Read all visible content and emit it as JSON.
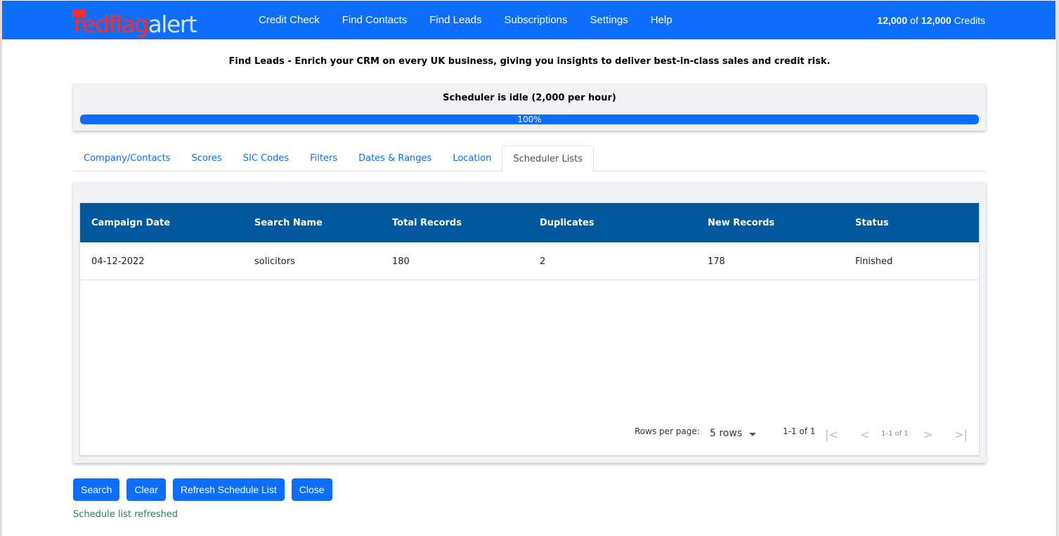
{
  "brand": {
    "logo_part_red": "redflag",
    "logo_part_white": "alert"
  },
  "nav": {
    "items": [
      "Credit Check",
      "Find Contacts",
      "Find Leads",
      "Subscriptions",
      "Settings",
      "Help"
    ],
    "credits_used": "12,000",
    "credits_of": "of",
    "credits_total": "12,000",
    "credits_label": "Credits"
  },
  "page": {
    "subtitle": "Find Leads - Enrich your CRM on every UK business, giving you insights to deliver best-in-class sales and credit risk."
  },
  "scheduler": {
    "status_text": "Scheduler is idle (2,000 per hour)",
    "progress_label": "100%",
    "progress_fraction": 1.0
  },
  "tabs": [
    {
      "label": "Company/Contacts",
      "active": false
    },
    {
      "label": "Scores",
      "active": false
    },
    {
      "label": "SIC Codes",
      "active": false
    },
    {
      "label": "Filters",
      "active": false
    },
    {
      "label": "Dates & Ranges",
      "active": false
    },
    {
      "label": "Location",
      "active": false
    },
    {
      "label": "Scheduler Lists",
      "active": true
    }
  ],
  "table": {
    "columns": [
      "Campaign Date",
      "Search Name",
      "Total Records",
      "Duplicates",
      "New Records",
      "Status"
    ],
    "rows": [
      [
        "04-12-2022",
        "solicitors",
        "180",
        "2",
        "178",
        "Finished"
      ]
    ]
  },
  "pager": {
    "rows_per_page_label": "Rows per page:",
    "rows_per_page_value": "5 rows",
    "range": "1-1 of 1",
    "range_small": "1-1 of 1"
  },
  "buttons": {
    "search": "Search",
    "clear": "Clear",
    "refresh": "Refresh Schedule List",
    "close": "Close"
  },
  "status_message": "Schedule list refreshed",
  "colors": {
    "nav": "#0d6efd",
    "table_header": "#02589c",
    "success": "#198754"
  }
}
